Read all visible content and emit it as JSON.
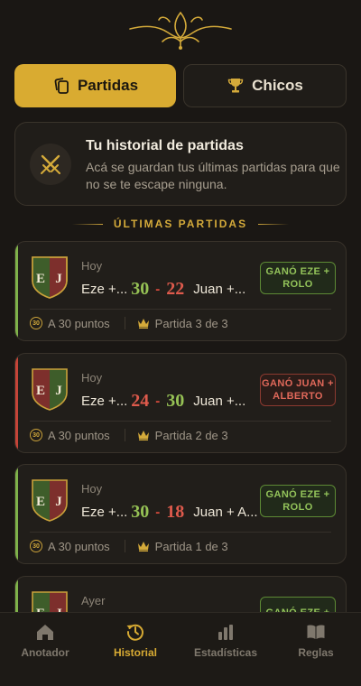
{
  "tabs": {
    "partidas": {
      "label": "Partidas",
      "icon": "cards-icon",
      "active": true
    },
    "chicos": {
      "label": "Chicos",
      "icon": "trophy-icon",
      "active": false
    }
  },
  "info": {
    "title": "Tu historial de partidas",
    "description": "Acá se guardan tus últimas partidas para que no se te escape ninguna."
  },
  "section_title": "ÚLTIMAS PARTIDAS",
  "matches": [
    {
      "when": "Hoy",
      "team1": "Eze +...",
      "score1": "30",
      "separator": "-",
      "score2": "22",
      "team2": "Juan +...",
      "result": "GANÓ EZE + ROLO",
      "points": "A 30 puntos",
      "points_badge": "30",
      "partida": "Partida 3 de 3",
      "shield_left": "E",
      "shield_right": "J"
    },
    {
      "when": "Hoy",
      "team1": "Eze +...",
      "score1": "24",
      "separator": "-",
      "score2": "30",
      "team2": "Juan +...",
      "result": "GANÓ JUAN + ALBERTO",
      "points": "A 30 puntos",
      "points_badge": "30",
      "partida": "Partida 2 de 3",
      "shield_left": "E",
      "shield_right": "J"
    },
    {
      "when": "Hoy",
      "team1": "Eze +...",
      "score1": "30",
      "separator": "-",
      "score2": "18",
      "team2": "Juan + A...",
      "result": "GANÓ EZE + ROLO",
      "points": "A 30 puntos",
      "points_badge": "30",
      "partida": "Partida 1 de 3",
      "shield_left": "E",
      "shield_right": "J"
    },
    {
      "when": "Ayer",
      "result": "GANÓ EZE +",
      "shield_left": "E",
      "shield_right": "J"
    }
  ],
  "nav": [
    {
      "label": "Anotador",
      "icon": "house-icon",
      "active": false
    },
    {
      "label": "Historial",
      "icon": "history-icon",
      "active": true
    },
    {
      "label": "Estadísticas",
      "icon": "bar-chart-icon",
      "active": false
    },
    {
      "label": "Reglas",
      "icon": "book-icon",
      "active": false
    }
  ],
  "colors": {
    "gold": "#d9ab31",
    "win": "#93c35a",
    "lose": "#e0685a",
    "background": "#1a1714"
  }
}
